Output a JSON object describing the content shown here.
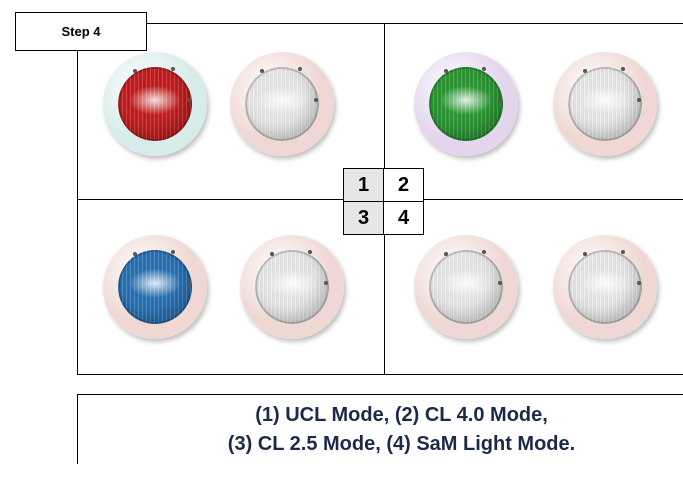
{
  "step_label": "Step 4",
  "quadrant_labels": [
    "1",
    "2",
    "3",
    "4"
  ],
  "caption": {
    "line1": "(1)  UCL Mode, (2) CL 4.0 Mode,",
    "line2": "(3) CL 2.5 Mode, (4) SaM Light Mode."
  },
  "lights": [
    {
      "quadrant": 1,
      "ring": "#d7ecea",
      "lens": "#c81e1e"
    },
    {
      "quadrant": 1,
      "ring": "#efd8d3",
      "lens": "#ececec"
    },
    {
      "quadrant": 2,
      "ring": "#e3d5ec",
      "lens": "#2e9a36"
    },
    {
      "quadrant": 2,
      "ring": "#efd8d3",
      "lens": "#ececec"
    },
    {
      "quadrant": 3,
      "ring": "#efd8d3",
      "lens": "#2a74b8"
    },
    {
      "quadrant": 3,
      "ring": "#efd8d3",
      "lens": "#ececec"
    },
    {
      "quadrant": 4,
      "ring": "#efd8d3",
      "lens": "#ececec"
    },
    {
      "quadrant": 4,
      "ring": "#efd8d3",
      "lens": "#ececec"
    }
  ]
}
